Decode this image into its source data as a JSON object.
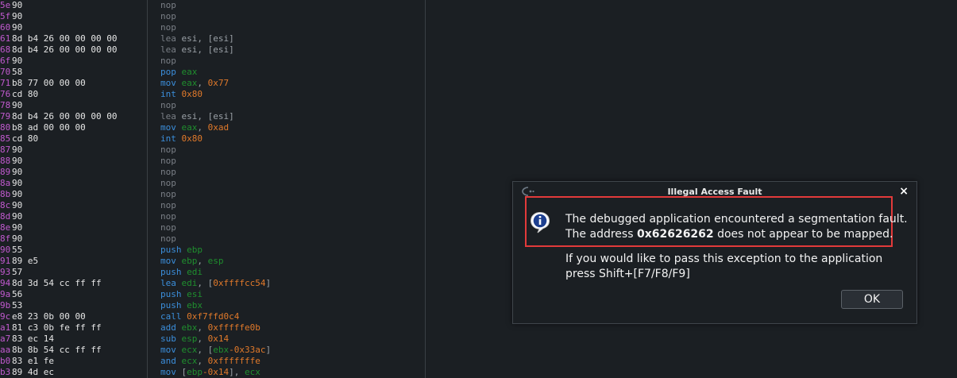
{
  "disassembly": [
    {
      "addr": "5e",
      "bytes": "90",
      "mnemonic": "nop",
      "args": []
    },
    {
      "addr": "5f",
      "bytes": "90",
      "mnemonic": "nop",
      "args": []
    },
    {
      "addr": "60",
      "bytes": "90",
      "mnemonic": "nop",
      "args": []
    },
    {
      "addr": "61",
      "bytes": "8d b4 26 00 00 00 00",
      "mnemonic": "lea",
      "args": [
        {
          "t": "plain",
          "v": "esi, [esi]"
        }
      ]
    },
    {
      "addr": "68",
      "bytes": "8d b4 26 00 00 00 00",
      "mnemonic": "lea",
      "args": [
        {
          "t": "plain",
          "v": "esi, [esi]"
        }
      ]
    },
    {
      "addr": "6f",
      "bytes": "90",
      "mnemonic": "nop",
      "args": []
    },
    {
      "addr": "70",
      "bytes": "58",
      "mnemonic": "pop",
      "active": true,
      "args": [
        {
          "t": "reg",
          "v": "eax"
        }
      ]
    },
    {
      "addr": "71",
      "bytes": "b8 77 00 00 00",
      "mnemonic": "mov",
      "active": true,
      "args": [
        {
          "t": "reg",
          "v": "eax"
        },
        {
          "t": "plain",
          "v": ", "
        },
        {
          "t": "num",
          "v": "0x77"
        }
      ]
    },
    {
      "addr": "76",
      "bytes": "cd 80",
      "mnemonic": "int",
      "active": true,
      "args": [
        {
          "t": "num",
          "v": "0x80"
        }
      ]
    },
    {
      "addr": "78",
      "bytes": "90",
      "mnemonic": "nop",
      "args": []
    },
    {
      "addr": "79",
      "bytes": "8d b4 26 00 00 00 00",
      "mnemonic": "lea",
      "args": [
        {
          "t": "plain",
          "v": "esi, [esi]"
        }
      ]
    },
    {
      "addr": "80",
      "bytes": "b8 ad 00 00 00",
      "mnemonic": "mov",
      "active": true,
      "args": [
        {
          "t": "reg",
          "v": "eax"
        },
        {
          "t": "plain",
          "v": ", "
        },
        {
          "t": "num",
          "v": "0xad"
        }
      ]
    },
    {
      "addr": "85",
      "bytes": "cd 80",
      "mnemonic": "int",
      "active": true,
      "args": [
        {
          "t": "num",
          "v": "0x80"
        }
      ]
    },
    {
      "addr": "87",
      "bytes": "90",
      "mnemonic": "nop",
      "args": []
    },
    {
      "addr": "88",
      "bytes": "90",
      "mnemonic": "nop",
      "args": []
    },
    {
      "addr": "89",
      "bytes": "90",
      "mnemonic": "nop",
      "args": []
    },
    {
      "addr": "8a",
      "bytes": "90",
      "mnemonic": "nop",
      "args": []
    },
    {
      "addr": "8b",
      "bytes": "90",
      "mnemonic": "nop",
      "args": []
    },
    {
      "addr": "8c",
      "bytes": "90",
      "mnemonic": "nop",
      "args": []
    },
    {
      "addr": "8d",
      "bytes": "90",
      "mnemonic": "nop",
      "args": []
    },
    {
      "addr": "8e",
      "bytes": "90",
      "mnemonic": "nop",
      "args": []
    },
    {
      "addr": "8f",
      "bytes": "90",
      "mnemonic": "nop",
      "args": []
    },
    {
      "addr": "90",
      "bytes": "55",
      "mnemonic": "push",
      "active": true,
      "args": [
        {
          "t": "reg",
          "v": "ebp"
        }
      ]
    },
    {
      "addr": "91",
      "bytes": "89 e5",
      "mnemonic": "mov",
      "active": true,
      "args": [
        {
          "t": "reg",
          "v": "ebp"
        },
        {
          "t": "plain",
          "v": ", "
        },
        {
          "t": "reg",
          "v": "esp"
        }
      ]
    },
    {
      "addr": "93",
      "bytes": "57",
      "mnemonic": "push",
      "active": true,
      "args": [
        {
          "t": "reg",
          "v": "edi"
        }
      ]
    },
    {
      "addr": "94",
      "bytes": "8d 3d 54 cc ff ff",
      "mnemonic": "lea",
      "active": true,
      "args": [
        {
          "t": "reg",
          "v": "edi"
        },
        {
          "t": "plain",
          "v": ", ["
        },
        {
          "t": "num",
          "v": "0xffffcc54"
        },
        {
          "t": "plain",
          "v": "]"
        }
      ]
    },
    {
      "addr": "9a",
      "bytes": "56",
      "mnemonic": "push",
      "active": true,
      "args": [
        {
          "t": "reg",
          "v": "esi"
        }
      ]
    },
    {
      "addr": "9b",
      "bytes": "53",
      "mnemonic": "push",
      "active": true,
      "args": [
        {
          "t": "reg",
          "v": "ebx"
        }
      ]
    },
    {
      "addr": "9c",
      "bytes": "e8 23 0b 00 00",
      "mnemonic": "call",
      "active": true,
      "args": [
        {
          "t": "num",
          "v": "0xf7ffd0c4"
        }
      ]
    },
    {
      "addr": "a1",
      "bytes": "81 c3 0b fe ff ff",
      "mnemonic": "add",
      "active": true,
      "args": [
        {
          "t": "reg",
          "v": "ebx"
        },
        {
          "t": "plain",
          "v": ", "
        },
        {
          "t": "num",
          "v": "0xfffffe0b"
        }
      ]
    },
    {
      "addr": "a7",
      "bytes": "83 ec 14",
      "mnemonic": "sub",
      "active": true,
      "args": [
        {
          "t": "reg",
          "v": "esp"
        },
        {
          "t": "plain",
          "v": ", "
        },
        {
          "t": "num",
          "v": "0x14"
        }
      ]
    },
    {
      "addr": "aa",
      "bytes": "8b 8b 54 cc ff ff",
      "mnemonic": "mov",
      "active": true,
      "args": [
        {
          "t": "reg",
          "v": "ecx"
        },
        {
          "t": "plain",
          "v": ", ["
        },
        {
          "t": "reg",
          "v": "ebx"
        },
        {
          "t": "num",
          "v": "-0x33ac"
        },
        {
          "t": "plain",
          "v": "]"
        }
      ]
    },
    {
      "addr": "b0",
      "bytes": "83 e1 fe",
      "mnemonic": "and",
      "active": true,
      "args": [
        {
          "t": "reg",
          "v": "ecx"
        },
        {
          "t": "plain",
          "v": ", "
        },
        {
          "t": "num",
          "v": "0xfffffffe"
        }
      ]
    },
    {
      "addr": "b3",
      "bytes": "89 4d ec",
      "mnemonic": "mov",
      "active": true,
      "args": [
        {
          "t": "plain",
          "v": "["
        },
        {
          "t": "reg",
          "v": "ebp"
        },
        {
          "t": "num",
          "v": "-0x14"
        },
        {
          "t": "plain",
          "v": "], "
        },
        {
          "t": "reg",
          "v": "ecx"
        }
      ]
    }
  ],
  "dialog": {
    "title": "Illegal Access Fault",
    "close_glyph": "×",
    "message_line1": "The debugged application encountered a segmentation fault.",
    "message_line2_prefix": "The address ",
    "message_line2_address": "0x62626262",
    "message_line2_suffix": " does not appear to be mapped.",
    "message_hint": "If you would like to pass this exception to the application press Shift+[F7/F8/F9]",
    "ok_label": "OK"
  },
  "colors": {
    "background": "#1b1f23",
    "address": "#c25ad0",
    "register": "#1f8f2e",
    "immediate": "#e0792a",
    "mnemonic_active": "#3b8edb",
    "mnemonic_nop": "#7a7f86",
    "highlight_border": "#e23a3a"
  }
}
